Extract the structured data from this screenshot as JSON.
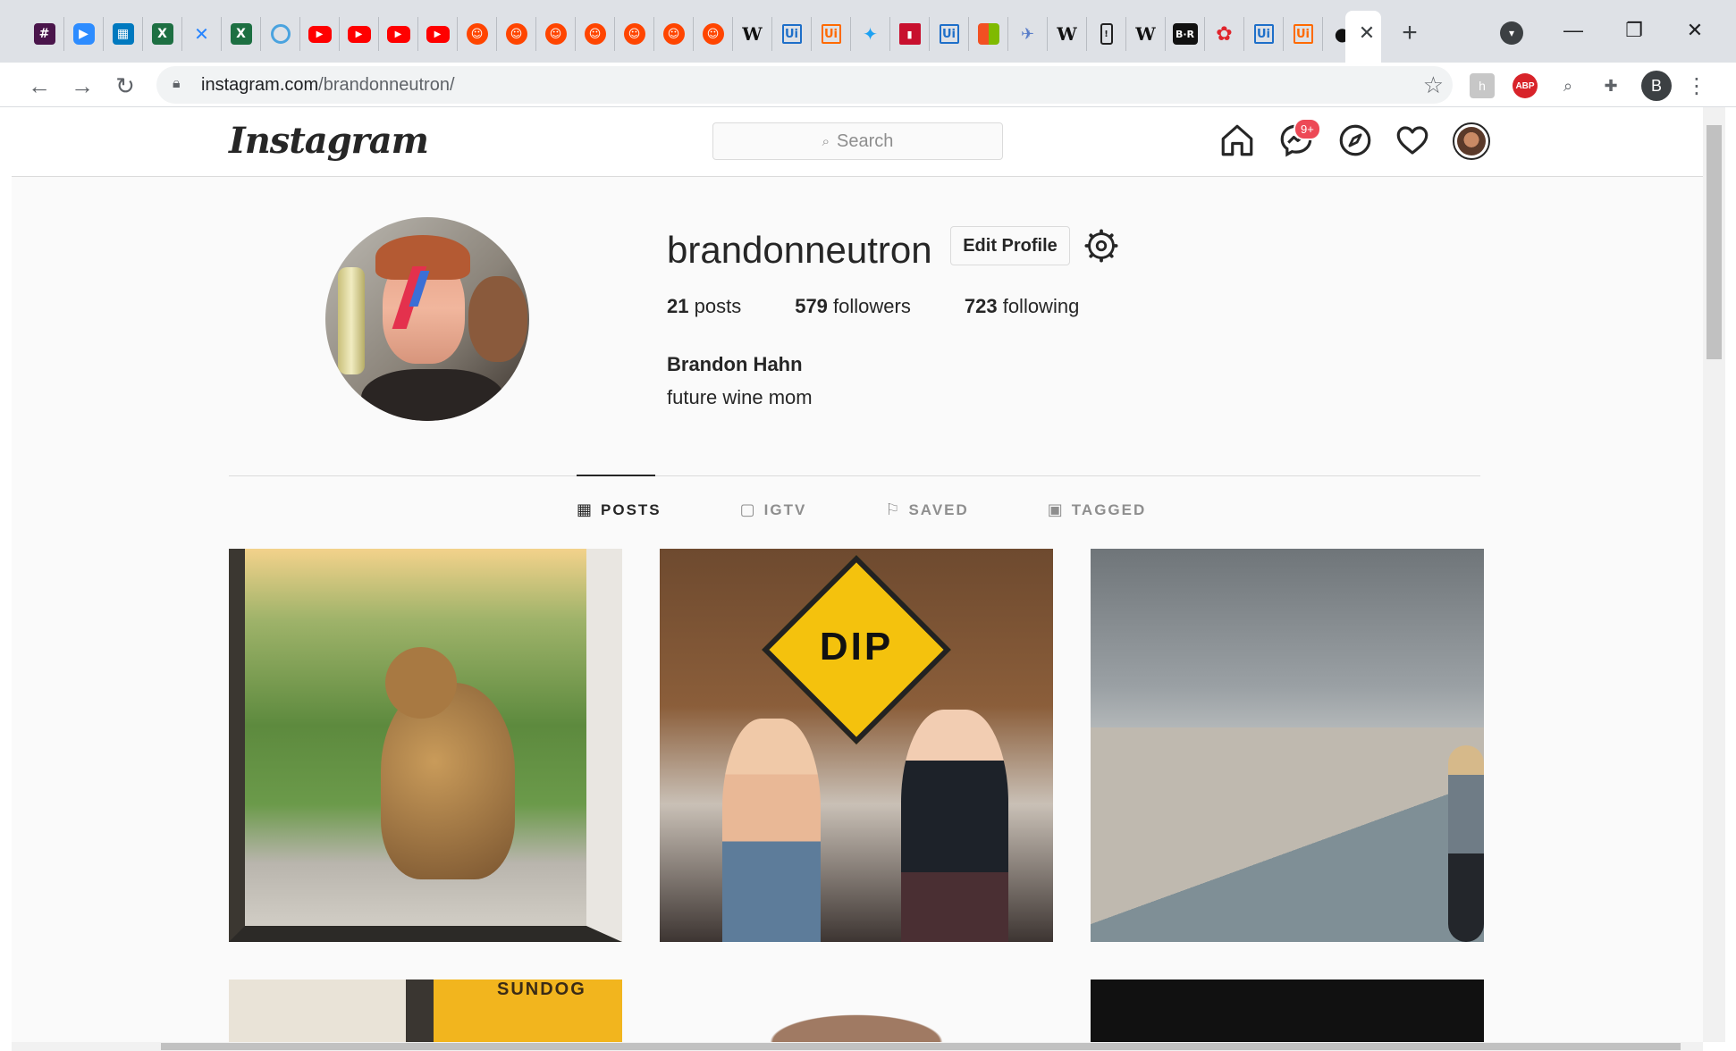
{
  "browser": {
    "tab_icons": [
      {
        "icon": "slack-icon",
        "cls": "slack",
        "glyph": "#"
      },
      {
        "icon": "zoom-icon",
        "cls": "zoom",
        "glyph": "▶"
      },
      {
        "icon": "trello-icon",
        "cls": "trello",
        "glyph": "▦"
      },
      {
        "icon": "excel-icon",
        "cls": "excel",
        "glyph": "X"
      },
      {
        "icon": "confluence-icon",
        "cls": "conf",
        "glyph": "✕"
      },
      {
        "icon": "excel-icon",
        "cls": "excel",
        "glyph": "X"
      },
      {
        "icon": "ring-icon",
        "cls": "ring",
        "glyph": ""
      },
      {
        "icon": "youtube-icon",
        "cls": "yt",
        "glyph": "▶"
      },
      {
        "icon": "youtube-icon",
        "cls": "yt",
        "glyph": "▶"
      },
      {
        "icon": "youtube-icon",
        "cls": "yt",
        "glyph": "▶"
      },
      {
        "icon": "youtube-icon",
        "cls": "yt",
        "glyph": "▶"
      },
      {
        "icon": "reddit-icon",
        "cls": "reddit",
        "glyph": "☺"
      },
      {
        "icon": "reddit-icon",
        "cls": "reddit",
        "glyph": "☺"
      },
      {
        "icon": "reddit-icon",
        "cls": "reddit",
        "glyph": "☺"
      },
      {
        "icon": "reddit-icon",
        "cls": "reddit",
        "glyph": "☺"
      },
      {
        "icon": "reddit-icon",
        "cls": "reddit",
        "glyph": "☺"
      },
      {
        "icon": "reddit-icon",
        "cls": "reddit",
        "glyph": "☺"
      },
      {
        "icon": "reddit-icon",
        "cls": "reddit",
        "glyph": "☺"
      },
      {
        "icon": "wikipedia-icon",
        "cls": "wiki",
        "glyph": "W"
      },
      {
        "icon": "uipath-icon",
        "cls": "ui",
        "glyph": "Ui"
      },
      {
        "icon": "uipath-orange-icon",
        "cls": "uio",
        "glyph": "Ui"
      },
      {
        "icon": "twitter-icon",
        "cls": "tw",
        "glyph": "✦"
      },
      {
        "icon": "chart-bars-icon",
        "cls": "bars",
        "glyph": "▮"
      },
      {
        "icon": "uipath-icon",
        "cls": "ui",
        "glyph": "Ui"
      },
      {
        "icon": "microsoft-icon",
        "cls": "ms",
        "glyph": ""
      },
      {
        "icon": "plane-icon",
        "cls": "plane",
        "glyph": "✈"
      },
      {
        "icon": "wikipedia-icon",
        "cls": "wiki",
        "glyph": "W"
      },
      {
        "icon": "phone-icon",
        "cls": "phone",
        "glyph": "!"
      },
      {
        "icon": "wikipedia-icon",
        "cls": "wiki",
        "glyph": "W"
      },
      {
        "icon": "br-icon",
        "cls": "br",
        "glyph": "B·R"
      },
      {
        "icon": "flower-icon",
        "cls": "flower",
        "glyph": "✿"
      },
      {
        "icon": "uipath-icon",
        "cls": "ui",
        "glyph": "Ui"
      },
      {
        "icon": "uipath-orange-icon",
        "cls": "uio",
        "glyph": "Ui"
      },
      {
        "icon": "github-icon",
        "cls": "gh",
        "glyph": "●"
      }
    ],
    "active_tab_close": "✕",
    "new_tab": "+",
    "tab_search": "▾",
    "window": {
      "minimize": "—",
      "restore": "❐",
      "close": "✕"
    },
    "nav": {
      "back": "←",
      "forward": "→",
      "reload": "↻"
    },
    "url_host": "instagram.com",
    "url_path": "/brandonneutron/",
    "bookmark_star": "☆",
    "extensions": {
      "history": "h",
      "abp": "ABP",
      "search": "⌕",
      "puzzle": "✚",
      "profile": "B",
      "menu": "⋮"
    }
  },
  "header": {
    "logo": "Instagram",
    "search_placeholder": "Search",
    "search_icon": "⌕",
    "messages_badge": "9+"
  },
  "profile": {
    "username": "brandonneutron",
    "edit_label": "Edit Profile",
    "stats": [
      {
        "count": "21",
        "label": "posts"
      },
      {
        "count": "579",
        "label": "followers"
      },
      {
        "count": "723",
        "label": "following"
      }
    ],
    "full_name": "Brandon Hahn",
    "bio": "future wine mom"
  },
  "tabs": [
    {
      "label": "POSTS",
      "icon": "▦",
      "active": true
    },
    {
      "label": "IGTV",
      "icon": "▢",
      "active": false
    },
    {
      "label": "SAVED",
      "icon": "⚐",
      "active": false
    },
    {
      "label": "TAGGED",
      "icon": "▣",
      "active": false
    }
  ],
  "posts": {
    "dip_sign": "DIP",
    "sundog": "SUNDOG"
  },
  "colors": {
    "chrome_bg": "#dee1e6",
    "page_bg": "#fafafa",
    "text": "#262626",
    "muted": "#8e8e8e",
    "badge": "#ed4956"
  }
}
